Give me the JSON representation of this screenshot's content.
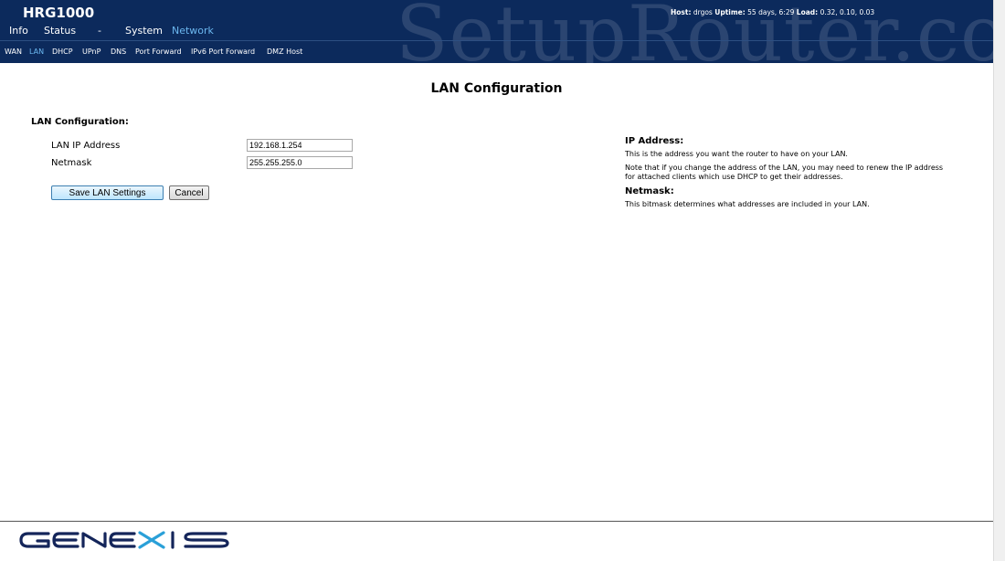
{
  "header": {
    "brand": "HRG1000",
    "watermark": "SetupRouter.co",
    "host_label": "Host:",
    "host_value": "drgos",
    "uptime_label": "Uptime:",
    "uptime_value": "55 days, 6:29",
    "load_label": "Load:",
    "load_value": "0.32, 0.10, 0.03",
    "background_color": "#0c2a5c",
    "active_color": "#6cb8f0"
  },
  "main_nav": {
    "items": [
      "Info",
      "Status",
      "-",
      "System",
      "Network"
    ],
    "active": "Network"
  },
  "sub_nav": {
    "items": [
      "WAN",
      "LAN",
      "DHCP",
      "UPnP",
      "DNS",
      "Port Forward",
      "IPv6 Port Forward",
      "DMZ Host"
    ],
    "active": "LAN"
  },
  "page": {
    "title": "LAN Configuration",
    "section_label": "LAN Configuration:",
    "fields": [
      {
        "label": "LAN IP Address",
        "value": "192.168.1.254"
      },
      {
        "label": "Netmask",
        "value": "255.255.255.0"
      }
    ],
    "save_button": "Save LAN Settings",
    "cancel_button": "Cancel"
  },
  "help": {
    "ip_title": "IP Address:",
    "ip_text_1": "This is the address you want the router to have on your LAN.",
    "ip_text_2": "Note that if you change the address of the LAN, you may need to renew the IP address for attached clients which use DHCP to get their addresses.",
    "netmask_title": "Netmask:",
    "netmask_text": "This bitmask determines what addresses are included in your LAN."
  },
  "footer": {
    "logo_text": "GENEXIS",
    "logo_color": "#14255a",
    "logo_x_color": "#2aa0d8"
  }
}
